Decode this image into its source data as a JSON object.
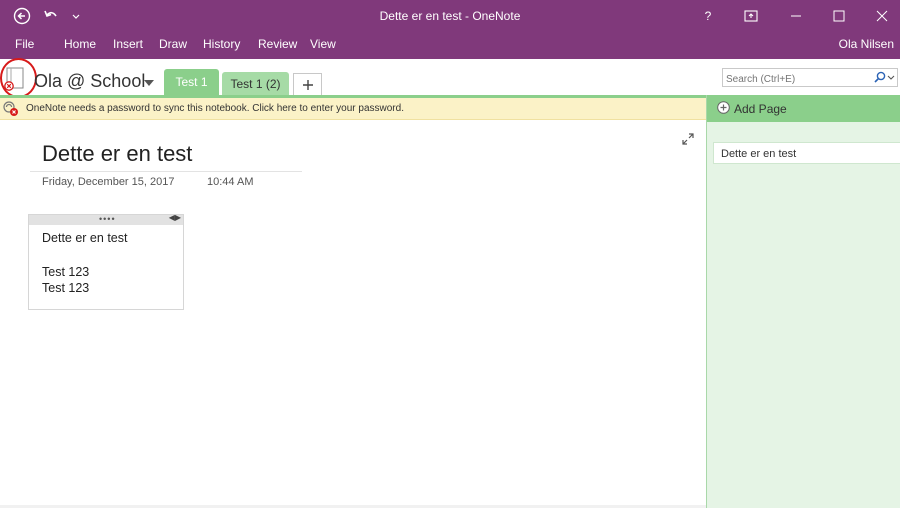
{
  "window": {
    "title": "Dette er en test - OneNote",
    "help_label": "?",
    "user": "Ola Nilsen"
  },
  "menu": {
    "items": [
      "File",
      "Home",
      "Insert",
      "Draw",
      "History",
      "Review",
      "View"
    ]
  },
  "notebook": {
    "name": "Ola @ School",
    "sync_status": "error"
  },
  "sections": [
    {
      "label": "Test 1",
      "active": true
    },
    {
      "label": "Test 1 (2)",
      "active": false
    }
  ],
  "search": {
    "placeholder": "Search (Ctrl+E)"
  },
  "infobar": {
    "message": "OneNote needs a password to sync this notebook. Click here to enter your password."
  },
  "page_pane": {
    "add_page_label": "Add Page",
    "pages": [
      "Dette er en test"
    ]
  },
  "page": {
    "title": "Dette er en test",
    "date": "Friday, December 15, 2017",
    "time": "10:44 AM",
    "note_lines": [
      "Dette er en test",
      "",
      "Test 123",
      "Test 123"
    ]
  },
  "colors": {
    "accent": "#80397b",
    "section_green": "#8bcf8b",
    "info_bg": "#fbf2c7"
  }
}
